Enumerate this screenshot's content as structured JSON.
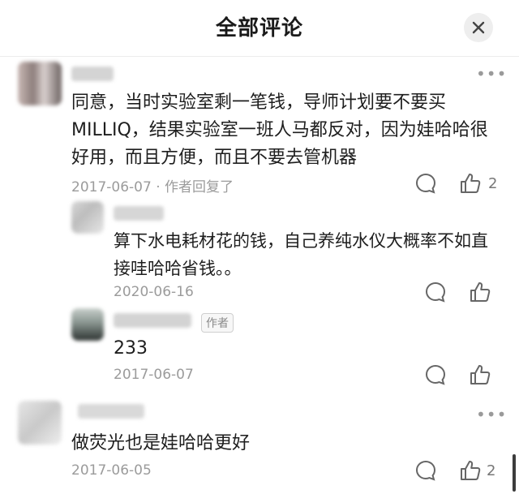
{
  "header": {
    "title": "全部评论"
  },
  "comments": [
    {
      "text": "同意，当时实验室剩一笔钱，导师计划要不要买MILLIQ，结果实验室一班人马都反对，因为娃哈哈很好用，而且方便，而且不要去管机器",
      "meta": "2017-06-07 · 作者回复了",
      "like_count": "2"
    },
    {
      "text": "算下水电耗材花的钱，自己养纯水仪大概率不如直接哇哈哈省钱。。",
      "meta": "2020-06-16"
    },
    {
      "author_tag": "作者",
      "text": "233",
      "meta": "2017-06-07"
    },
    {
      "text": "做荧光也是娃哈哈更好",
      "meta": "2017-06-05",
      "like_count": "2"
    }
  ],
  "icons": {
    "close": "close-icon",
    "more": "more-icon",
    "comment": "comment-icon",
    "like": "thumbs-up-icon"
  },
  "colors": {
    "text": "#1e1e1e",
    "meta": "#9b9b9b",
    "close_bg": "#eeeeee"
  }
}
